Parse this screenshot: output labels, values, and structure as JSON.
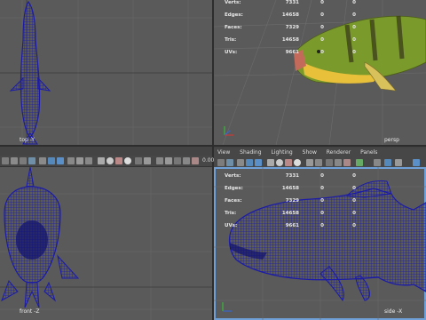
{
  "viewports": {
    "top": {
      "label": "top -Y"
    },
    "persp": {
      "label": "persp",
      "hud": [
        {
          "label": "Verts:",
          "value": "7331",
          "col2": "0",
          "col3": "0"
        },
        {
          "label": "Edges:",
          "value": "14658",
          "col2": "0",
          "col3": "0"
        },
        {
          "label": "Faces:",
          "value": "7329",
          "col2": "0",
          "col3": "0"
        },
        {
          "label": "Tris:",
          "value": "14658",
          "col2": "0",
          "col3": "0"
        },
        {
          "label": "UVs:",
          "value": "9661",
          "col2": "0",
          "col3": "0"
        }
      ]
    },
    "front": {
      "label": "front -Z",
      "zoom": "0.00"
    },
    "side": {
      "label": "side -X",
      "hud": [
        {
          "label": "Verts:",
          "value": "7331",
          "col2": "0",
          "col3": "0"
        },
        {
          "label": "Edges:",
          "value": "14658",
          "col2": "0",
          "col3": "0"
        },
        {
          "label": "Faces:",
          "value": "7329",
          "col2": "0",
          "col3": "0"
        },
        {
          "label": "Tris:",
          "value": "14658",
          "col2": "0",
          "col3": "0"
        },
        {
          "label": "UVs:",
          "value": "9661",
          "col2": "0",
          "col3": "0"
        }
      ]
    }
  },
  "panel_menu": [
    "View",
    "Shading",
    "Lighting",
    "Show",
    "Renderer",
    "Panels"
  ],
  "colors": {
    "wire": "#1b1ba8",
    "viewport_bg": "#5a5a5a",
    "active_border": "#6fa0d8"
  }
}
